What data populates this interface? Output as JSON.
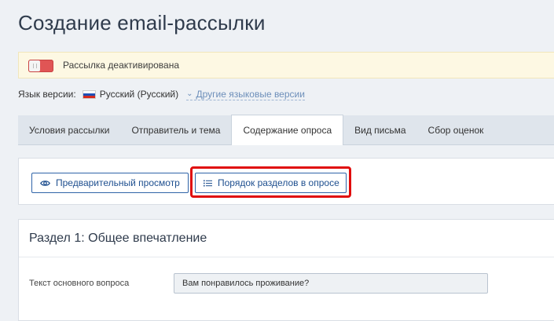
{
  "page": {
    "title": "Создание email-рассылки"
  },
  "notice": {
    "text": "Рассылка деактивирована",
    "toggle_state": "off",
    "toggle_color": "#e05555"
  },
  "language": {
    "label": "Язык версии:",
    "current": "Русский (Русский)",
    "other_link": "Другие языковые версии"
  },
  "tabs": [
    {
      "label": "Условия рассылки",
      "active": false
    },
    {
      "label": "Отправитель и тема",
      "active": false
    },
    {
      "label": "Содержание опроса",
      "active": true
    },
    {
      "label": "Вид письма",
      "active": false
    },
    {
      "label": "Сбор оценок",
      "active": false
    }
  ],
  "toolbar": {
    "preview_label": "Предварительный просмотр",
    "preview_icon": "eye-icon",
    "order_label": "Порядок разделов в опросе",
    "order_icon": "list-icon",
    "highlight_color": "#e00d0d"
  },
  "section": {
    "title": "Раздел 1: Общее впечатление",
    "field_label": "Текст основного вопроса",
    "field_value": "Вам понравилось проживание?"
  }
}
